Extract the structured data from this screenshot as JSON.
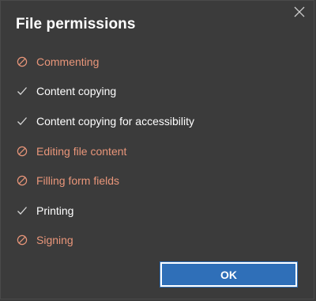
{
  "dialog": {
    "title": "File permissions",
    "close_icon": "close-icon",
    "ok_label": "OK",
    "colors": {
      "background": "#3b3b3b",
      "denied_text": "#e9967a",
      "allowed_text": "#ffffff",
      "ok_button": "#2f6fb8"
    }
  },
  "permissions": [
    {
      "label": "Commenting",
      "allowed": false,
      "icon": "denied-icon"
    },
    {
      "label": "Content copying",
      "allowed": true,
      "icon": "checkmark-icon"
    },
    {
      "label": "Content copying for accessibility",
      "allowed": true,
      "icon": "checkmark-icon"
    },
    {
      "label": "Editing file content",
      "allowed": false,
      "icon": "denied-icon"
    },
    {
      "label": "Filling form fields",
      "allowed": false,
      "icon": "denied-icon"
    },
    {
      "label": "Printing",
      "allowed": true,
      "icon": "checkmark-icon"
    },
    {
      "label": "Signing",
      "allowed": false,
      "icon": "denied-icon"
    }
  ]
}
